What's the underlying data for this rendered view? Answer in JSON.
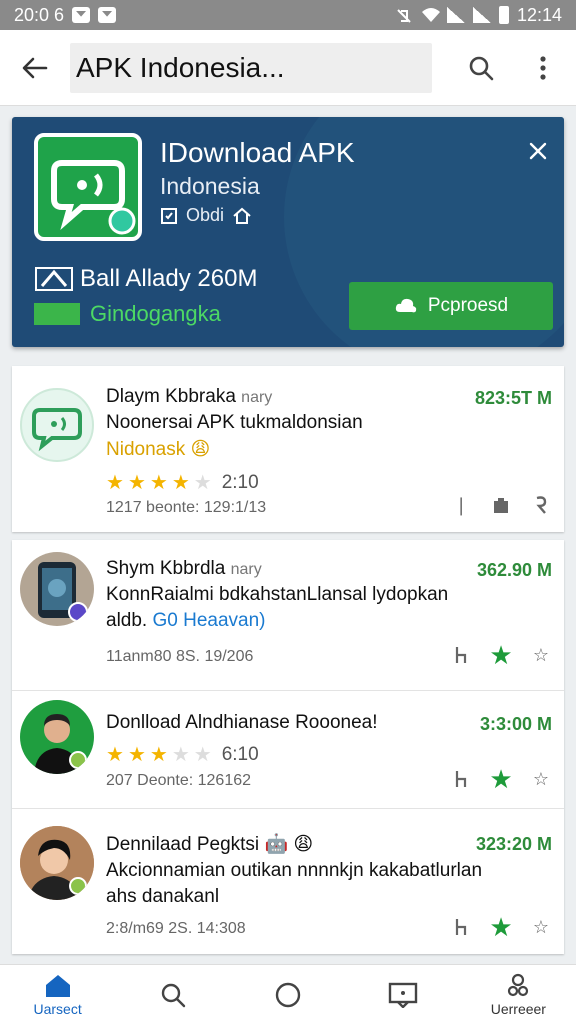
{
  "status_bar": {
    "time_left": "20:0 6",
    "time_right": "12:14"
  },
  "app_bar": {
    "search_value": "APK Indonesia..."
  },
  "featured": {
    "title": "IDownload APK",
    "subtitle": "Indonesia",
    "meta": "Obdi",
    "stat": "Ball Allady 260M",
    "category": "Gindogangka",
    "button_label": "Pcproesd",
    "colors": {
      "background": "#1f4b76",
      "button": "#2ea043",
      "category": "#4cd964"
    }
  },
  "list": [
    {
      "title": "Dlaym Kbbraka",
      "title_suffix": "nary",
      "size": "823:5T M",
      "desc": "Noonersai APK tukmaldonsian",
      "desc2": "Nidonask",
      "desc2_color": "#d9a100",
      "rating": "2:10",
      "stars": 4,
      "date": "1217 beonte: 129:1/13",
      "avatar_icon": "chat-app-icon"
    },
    {
      "title": "Shym Kbbrdla",
      "title_suffix": "nary",
      "size": "362.90 M",
      "desc": "KonnRaialmi bdkahstanLlansal lydopkan",
      "desc2_prefix": "aldb.",
      "desc2": "G0 Heaavan)",
      "desc2_color": "#1a7ad0",
      "date": "11anm80 8S. 19/206",
      "avatar_icon": "phone-app-icon"
    },
    {
      "title": "Donlload Alndhianase Rooonea!",
      "size": "3:3:00 M",
      "rating": "6:10",
      "stars": 3,
      "date": "207 Deonte: 126162",
      "avatar_icon": "person-avatar-icon"
    },
    {
      "title": "Dennilaad Pegktsi",
      "size": "323:20 M",
      "desc": "Akcionnamian outikan nnnnkjn kakabatlurlan",
      "desc2": "ahs danakanl",
      "desc2_color": "#111111",
      "date": "2:8/m69 2S. 14:308",
      "avatar_icon": "person-avatar-icon"
    }
  ],
  "bottom_nav": {
    "home_label": "Uarsect",
    "profile_label": "Uerreeer"
  }
}
